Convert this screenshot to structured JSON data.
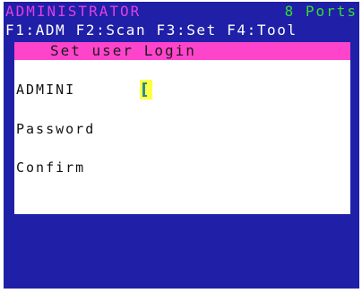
{
  "header": {
    "title": "ADMINISTRATOR",
    "ports": "8 Ports",
    "function_keys": "F1:ADM F2:Scan F3:Set F4:Tool"
  },
  "dialog": {
    "title": "Set user Login",
    "fields": [
      {
        "label": "ADMINI",
        "value": ""
      },
      {
        "label": "Password",
        "value": ""
      },
      {
        "label": "Confirm",
        "value": ""
      }
    ]
  },
  "colors": {
    "screen_background": "#1f1fa8",
    "title_text": "#e040e0",
    "ports_text": "#33dd33",
    "dialog_title_bar": "#ff44cc",
    "input_highlight": "#ffff44"
  }
}
